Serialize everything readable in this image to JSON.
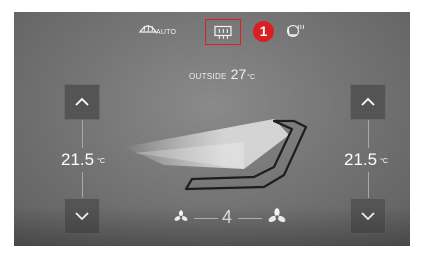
{
  "top_bar": {
    "defrost_auto_label": "AUTO",
    "callout_number": "1"
  },
  "outside": {
    "label": "OUTSIDE",
    "value": "27",
    "unit": "°C"
  },
  "left_zone": {
    "temperature": "21.5",
    "unit": "°C"
  },
  "right_zone": {
    "temperature": "21.5",
    "unit": "°C"
  },
  "fan": {
    "speed": "4"
  },
  "icons": {
    "front_defrost": "front-defrost-auto-icon",
    "rear_defrost": "rear-defrost-icon",
    "seat_heat": "seat-heating-icon",
    "up": "chevron-up-icon",
    "down": "chevron-down-icon",
    "fan_low": "fan-low-icon",
    "fan_high": "fan-high-icon",
    "seat": "seat-airflow-icon"
  },
  "colors": {
    "highlight": "#e02020",
    "callout": "#d81f26"
  }
}
